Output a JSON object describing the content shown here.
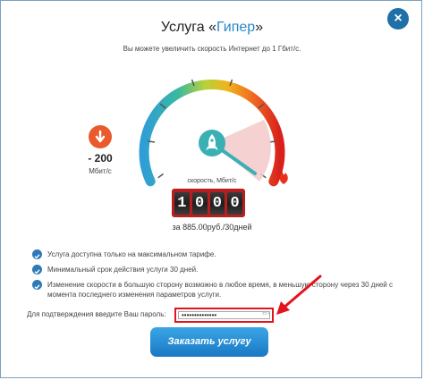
{
  "dialog": {
    "close_label": "×",
    "title_prefix": "Услуга «",
    "title_accent": "Гипер",
    "title_suffix": "»",
    "subtitle": "Вы можете увеличить скорость Интернет до 1 Гбит/с."
  },
  "gauge": {
    "delta_value": "- 200",
    "delta_unit": "Мбит/с",
    "speed_label": "скорость, Мбит/с",
    "digits": [
      "1",
      "0",
      "0",
      "0"
    ],
    "price": "за 885.00руб./30дней",
    "needle_fraction": 0.78
  },
  "features": [
    "Услуга доступна только на максимальном тарифе.",
    "Минимальный срок действия услуги 30 дней.",
    "Изменение скорости в большую сторону возможно в любое время, в меньшую сторону через 30 дней с момента последнего изменения параметров услуги."
  ],
  "password": {
    "label": "Для подтверждения введите Ваш пароль:",
    "value": "••••••••••••••",
    "lang": "en"
  },
  "submit_label": "Заказать услугу",
  "colors": {
    "accent": "#2a88c9",
    "button": "#1a78c5",
    "highlight": "#e3141b",
    "down": "#ea5a2c"
  },
  "icons": [
    "close-icon",
    "arrow-down-icon",
    "rocket-icon",
    "flame-icon",
    "check-icon",
    "red-arrow-icon"
  ]
}
